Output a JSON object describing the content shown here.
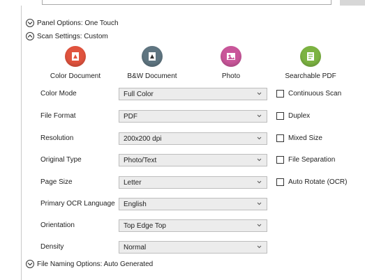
{
  "panel_options": {
    "label": "Panel Options: One Touch",
    "state": "collapsed"
  },
  "scan_settings": {
    "label": "Scan Settings: Custom",
    "state": "expanded"
  },
  "file_naming": {
    "label": "File Naming Options: Auto Generated",
    "state": "collapsed"
  },
  "profiles": [
    {
      "label": "Color Document",
      "icon": "color-document-icon",
      "color": "#e0533e"
    },
    {
      "label": "B&W Document",
      "icon": "bw-document-icon",
      "color": "#5f7581"
    },
    {
      "label": "Photo",
      "icon": "photo-icon",
      "color": "#c9569a"
    },
    {
      "label": "Searchable PDF",
      "icon": "searchable-pdf-icon",
      "color": "#7cb342"
    }
  ],
  "settings": [
    {
      "label": "Color Mode",
      "value": "Full Color"
    },
    {
      "label": "File Format",
      "value": "PDF"
    },
    {
      "label": "Resolution",
      "value": "200x200 dpi"
    },
    {
      "label": "Original Type",
      "value": "Photo/Text"
    },
    {
      "label": "Page Size",
      "value": "Letter"
    },
    {
      "label": "Primary OCR Language",
      "value": "English"
    },
    {
      "label": "Orientation",
      "value": "Top Edge Top"
    },
    {
      "label": "Density",
      "value": "Normal"
    }
  ],
  "checkboxes": [
    {
      "label": "Continuous Scan",
      "checked": false
    },
    {
      "label": "Duplex",
      "checked": false
    },
    {
      "label": "Mixed Size",
      "checked": false
    },
    {
      "label": "File Separation",
      "checked": false
    },
    {
      "label": "Auto Rotate (OCR)",
      "checked": false
    }
  ]
}
